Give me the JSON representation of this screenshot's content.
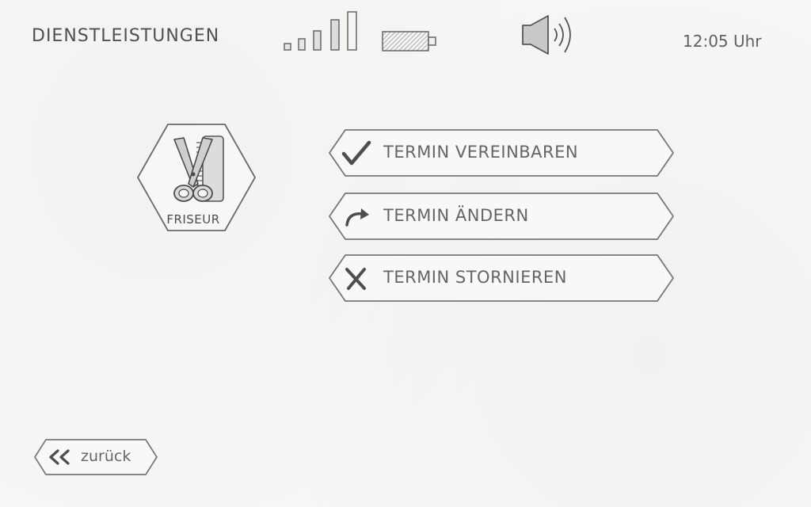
{
  "header": {
    "title": "DIENSTLEISTUNGEN",
    "time": "12:05 Uhr",
    "signal_icon": "signal-strength-icon",
    "battery_icon": "battery-icon",
    "volume_icon": "speaker-volume-icon"
  },
  "service": {
    "label": "FRISEUR",
    "icon": "scissors-comb-icon"
  },
  "actions": [
    {
      "label": "TERMIN VEREINBAREN",
      "icon": "checkmark-icon"
    },
    {
      "label": "TERMIN ÄNDERN",
      "icon": "redo-arrow-icon"
    },
    {
      "label": "TERMIN STORNIEREN",
      "icon": "cross-icon"
    }
  ],
  "navigation": {
    "back_label": "zurück",
    "back_icon": "double-chevron-left-icon"
  },
  "colors": {
    "paper": "#f6f6f4",
    "pencil": "#5a5a5a",
    "pencil_light": "#8a8a8a"
  }
}
